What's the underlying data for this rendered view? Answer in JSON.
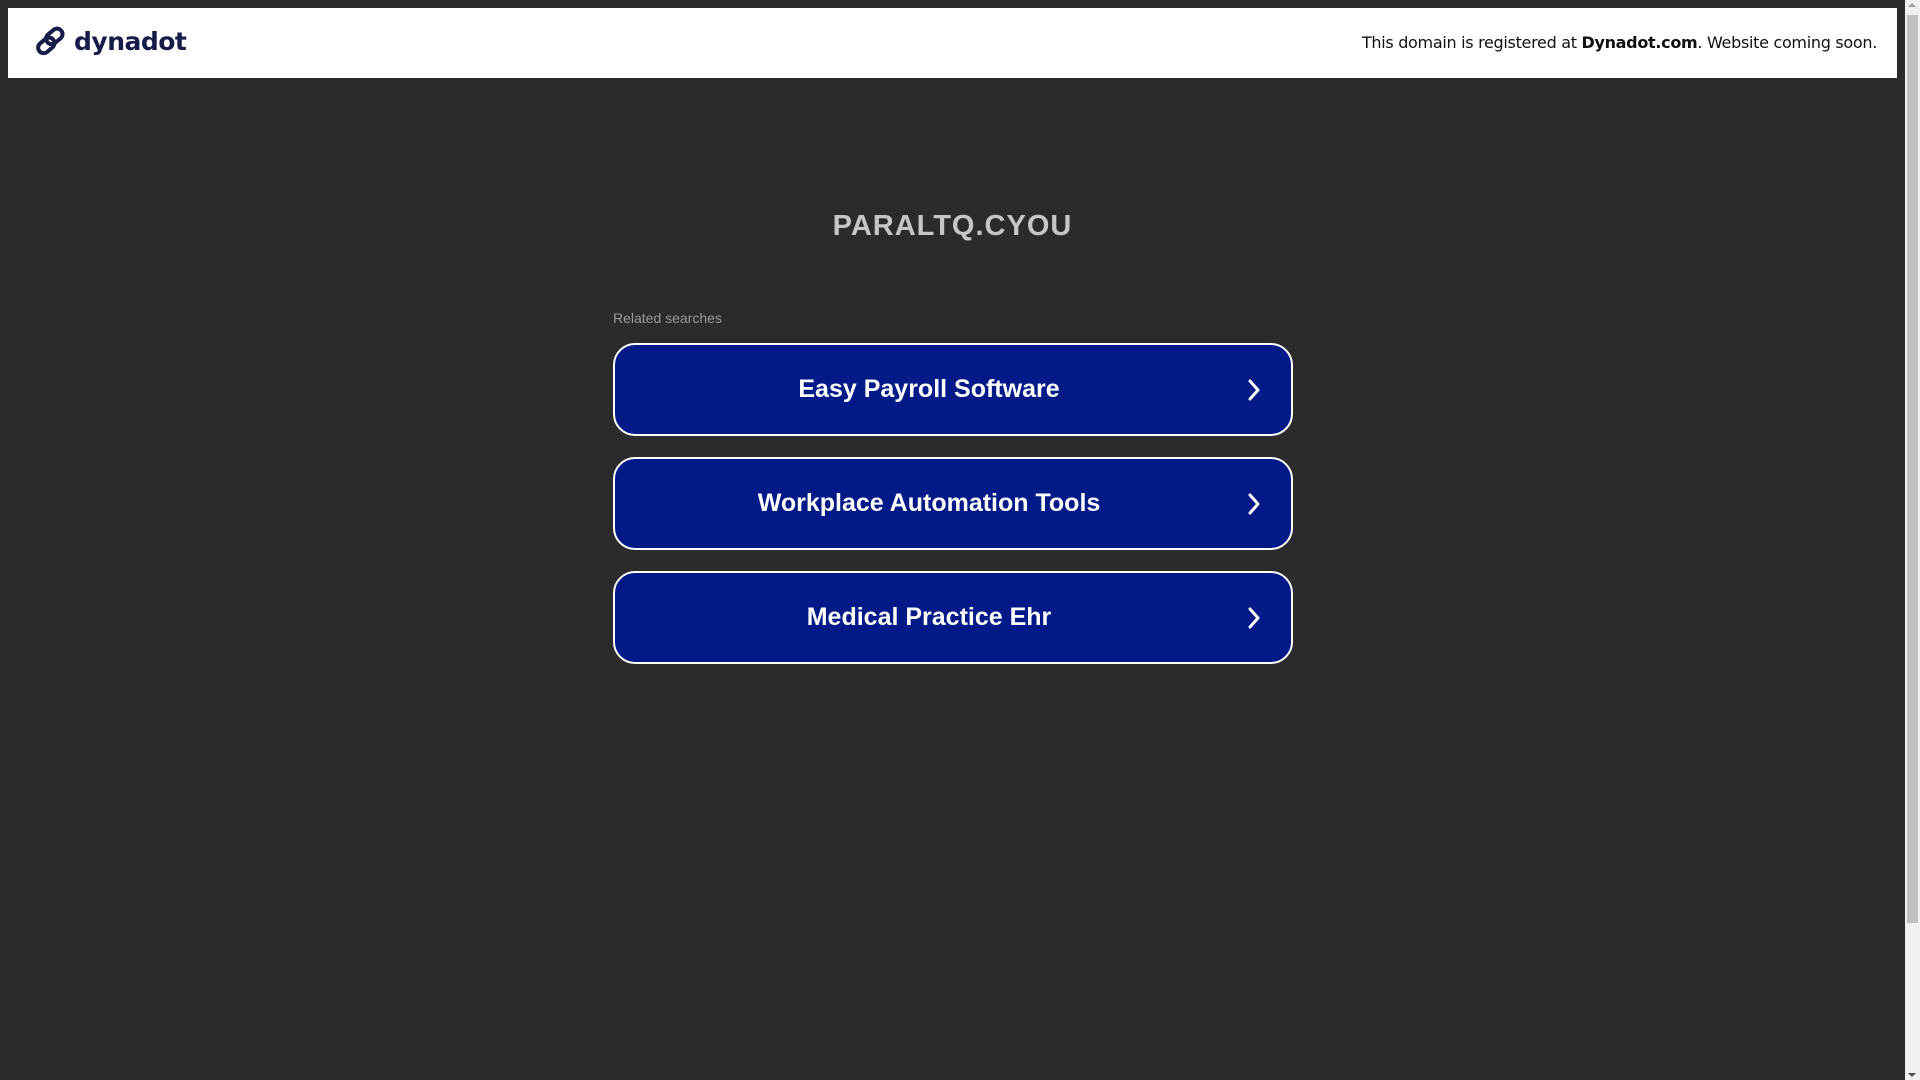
{
  "header": {
    "logo_text": "dynadot",
    "notice_prefix": "This domain is registered at ",
    "notice_brand": "Dynadot.com",
    "notice_suffix": ". Website coming soon."
  },
  "main": {
    "domain_title": "PARALTQ.CYOU",
    "related_label": "Related searches",
    "searches": [
      {
        "label": "Easy Payroll Software"
      },
      {
        "label": "Workplace Automation Tools"
      },
      {
        "label": "Medical Practice Ehr"
      }
    ]
  },
  "colors": {
    "background": "#2b2b2b",
    "button": "#021a88",
    "logo": "#161c4a"
  }
}
